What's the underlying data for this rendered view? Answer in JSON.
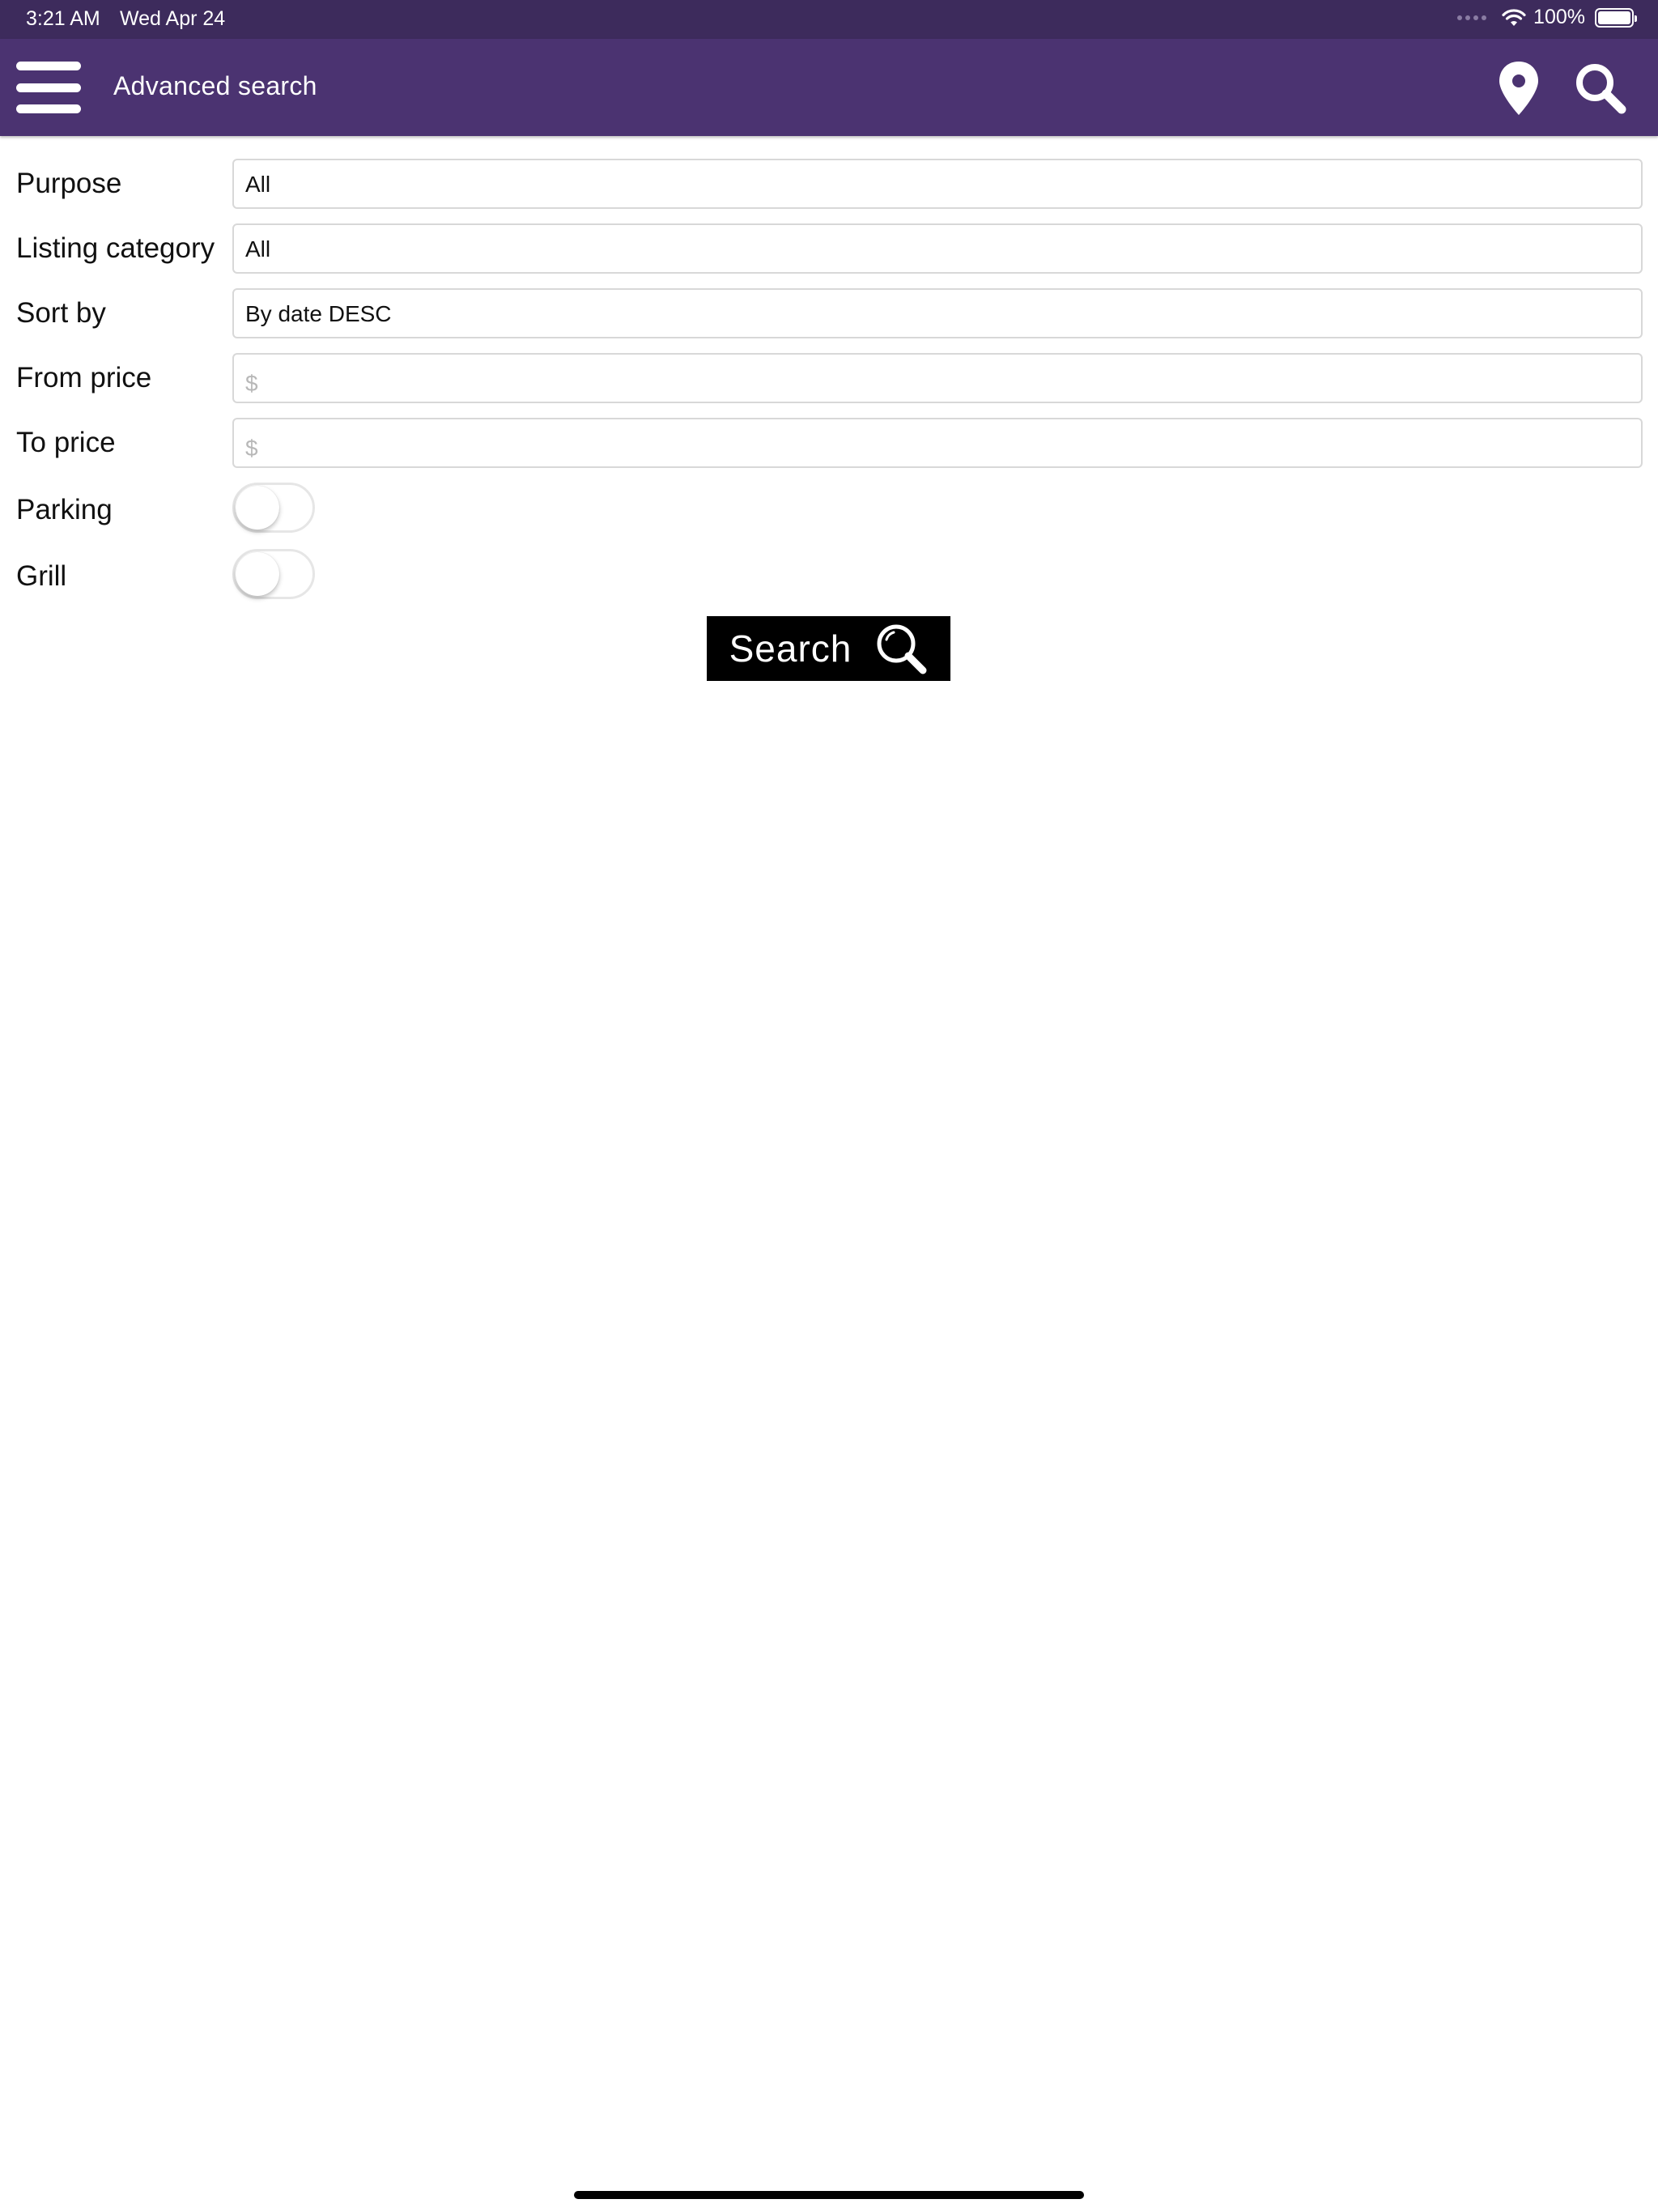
{
  "status_bar": {
    "time": "3:21 AM",
    "date": "Wed Apr 24",
    "battery": "100%"
  },
  "header": {
    "title": "Advanced search",
    "icons": [
      "menu-icon",
      "location-pin-icon",
      "search-icon"
    ],
    "color": "#4b3371"
  },
  "form": {
    "purpose": {
      "label": "Purpose",
      "value": "All"
    },
    "listing_category": {
      "label": "Listing category",
      "value": "All"
    },
    "sort_by": {
      "label": "Sort by",
      "value": "By date DESC"
    },
    "from_price": {
      "label": "From price",
      "placeholder": "$",
      "value": ""
    },
    "to_price": {
      "label": "To price",
      "placeholder": "$",
      "value": ""
    },
    "parking": {
      "label": "Parking",
      "on": false
    },
    "grill": {
      "label": "Grill",
      "on": false
    }
  },
  "search_button": {
    "label": "Search"
  }
}
